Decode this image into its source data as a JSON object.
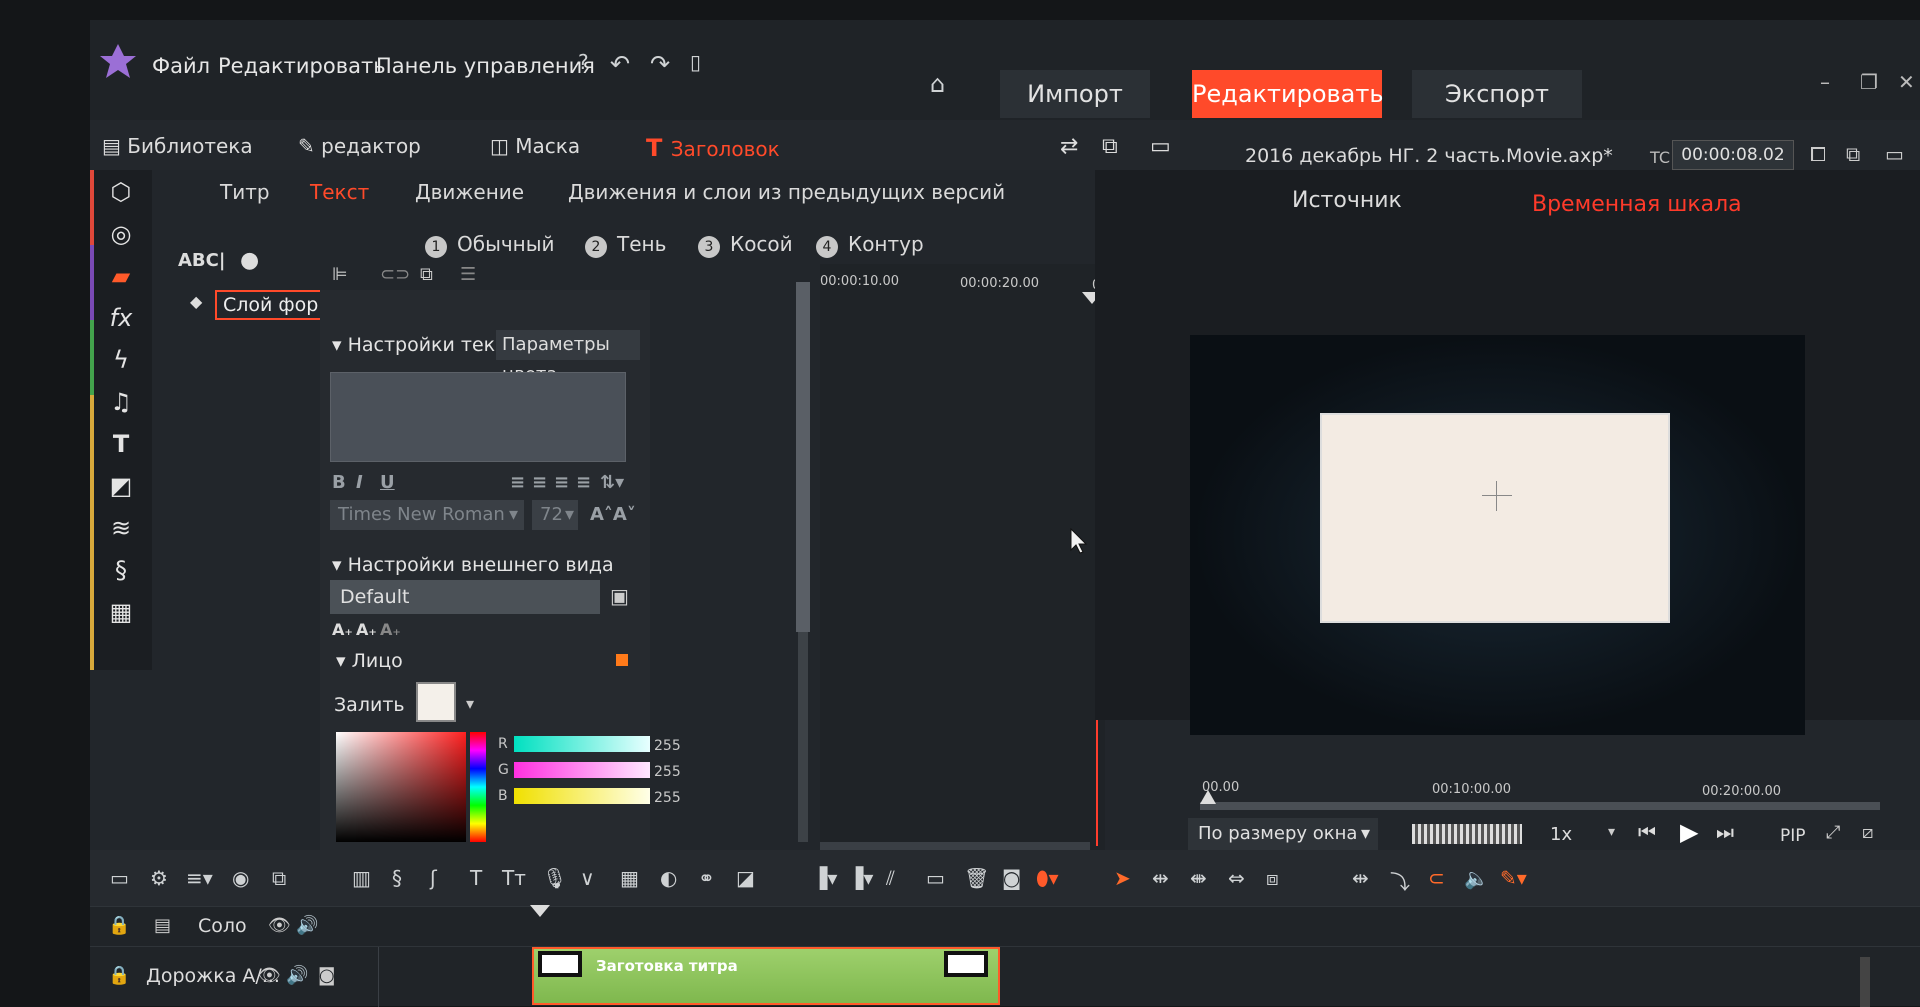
{
  "menu": {
    "file": "Файл",
    "edit": "Редактировать",
    "control_panel": "Панель управления",
    "help_icon": "question-icon",
    "undo_icon": "undo-icon",
    "redo_icon": "redo-icon"
  },
  "modes": {
    "import": "Импорт",
    "edit": "Редактировать",
    "export": "Экспорт"
  },
  "tabs": {
    "library": "Библиотека",
    "editor": "редактор",
    "mask": "Маска",
    "title": "Заголовок"
  },
  "subtabs": {
    "titr": "Титр",
    "text": "Текст",
    "motion": "Движение",
    "legacy": "Движения и слои из предыдущих версий"
  },
  "styles": [
    {
      "num": "1",
      "label": "Обычный"
    },
    {
      "num": "2",
      "label": "Тень"
    },
    {
      "num": "3",
      "label": "Косой"
    },
    {
      "num": "4",
      "label": "Контур"
    }
  ],
  "layers": {
    "abc": "ABC|",
    "shape_layer": "Слой форм"
  },
  "text_settings": {
    "header": "Настройки текста",
    "color_params": "Параметры цвета",
    "font": "Times New Roman",
    "size": "72"
  },
  "appearance": {
    "header": "Настройки внешнего вида",
    "preset": "Default",
    "face": "Лицо",
    "fill": "Залить",
    "r_label": "R",
    "r": "255",
    "g_label": "G",
    "g": "255",
    "b_label": "B",
    "b": "255"
  },
  "timeline": {
    "tc1": "00:00:10.00",
    "tc2": "00:00:20.00",
    "tc0": "0"
  },
  "project": {
    "filename": "2016 декабрь НГ. 2 часть.Movie.axp*",
    "tc_label": "TC",
    "timecode": "00:00:08.02"
  },
  "preview": {
    "source": "Источник",
    "timeline": "Временная шкала",
    "ruler0": "00.00",
    "ruler1": "00:10:00.00",
    "ruler2": "00:20:00.00",
    "fit": "По размеру окна",
    "speed": "1x",
    "pip": "PIP"
  },
  "tracks": {
    "solo": "Соло",
    "track_av": "Дорожка А/...",
    "clip_label": "Заготовка титра"
  }
}
